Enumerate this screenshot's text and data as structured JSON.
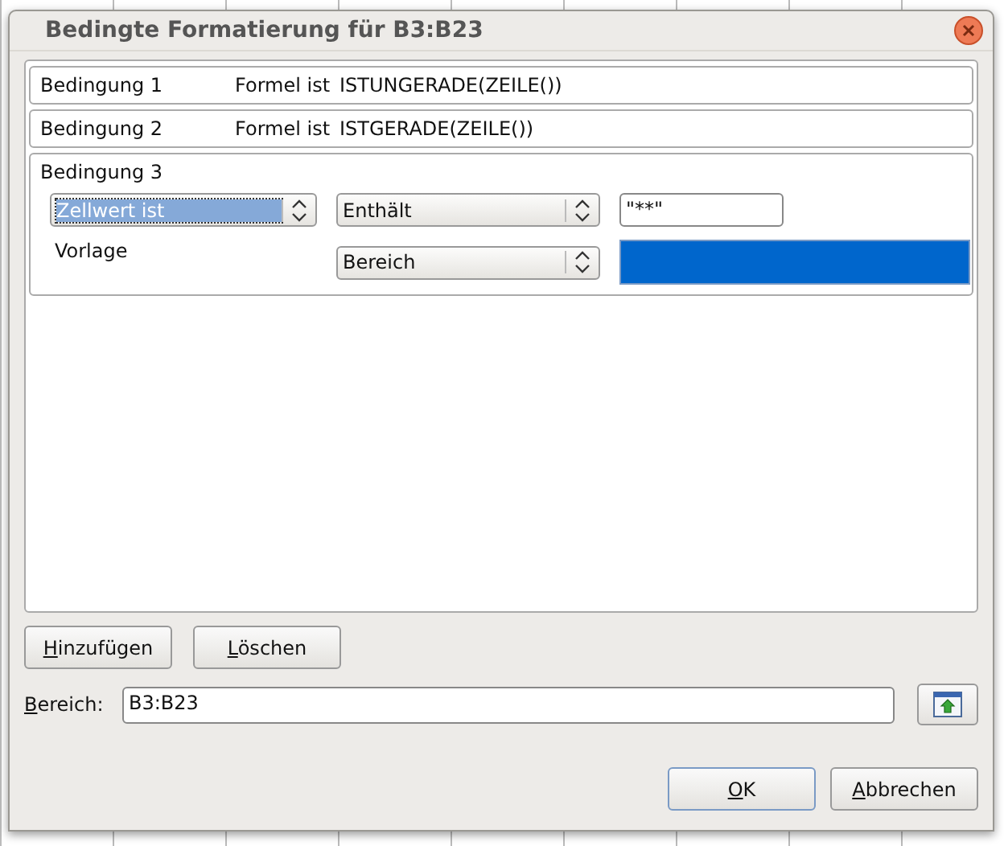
{
  "window": {
    "title": "Bedingte Formatierung für B3:B23"
  },
  "conditions": [
    {
      "kind": "formula",
      "label": "Bedingung 1",
      "type": "Formel ist",
      "formula": "ISTUNGERADE(ZEILE())"
    },
    {
      "kind": "formula",
      "label": "Bedingung 2",
      "type": "Formel ist",
      "formula": "ISTGERADE(ZEILE())"
    },
    {
      "kind": "cell",
      "label": "Bedingung 3",
      "type": "Zellwert ist",
      "type_focused": true,
      "operator": "Enthält",
      "value": "\"**\"",
      "style_label": "Vorlage",
      "style": "Bereich"
    }
  ],
  "buttons": [
    "Hinzufügen",
    "Löschen"
  ],
  "range": {
    "label": "Bereich:",
    "value": "B3:B23"
  },
  "footer_buttons": [
    {
      "label": "OK",
      "default": true
    },
    {
      "label": "Abbrechen",
      "default": false
    }
  ]
}
